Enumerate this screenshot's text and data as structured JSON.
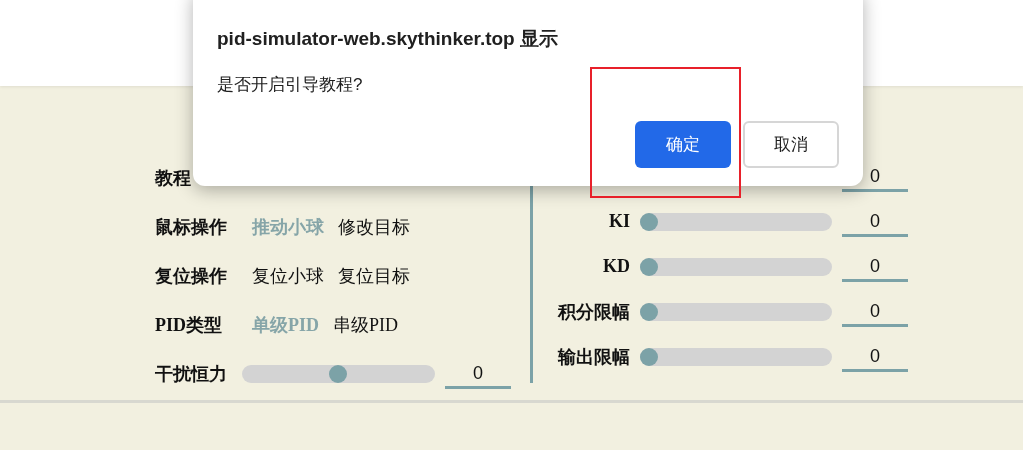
{
  "dialog": {
    "title": "pid-simulator-web.skythinker.top 显示",
    "message": "是否开启引导教程?",
    "buttons": [
      {
        "label": "确定",
        "kind": "primary",
        "highlighted": true
      },
      {
        "label": "取消",
        "kind": "secondary",
        "highlighted": false
      }
    ]
  },
  "controls": [
    {
      "kind": "label_only",
      "label": "教程"
    },
    {
      "kind": "options",
      "label": "鼠标操作",
      "options": [
        {
          "label": "推动小球",
          "selected": true
        },
        {
          "label": "修改目标",
          "selected": false
        }
      ]
    },
    {
      "kind": "options",
      "label": "复位操作",
      "options": [
        {
          "label": "复位小球",
          "selected": false
        },
        {
          "label": "复位目标",
          "selected": false
        }
      ]
    },
    {
      "kind": "options",
      "label": "PID类型",
      "options": [
        {
          "label": "单级PID",
          "selected": true
        },
        {
          "label": "串级PID",
          "selected": false
        }
      ]
    },
    {
      "kind": "slider",
      "label": "干扰恒力",
      "level": 0.5,
      "value": "0"
    }
  ],
  "gains": [
    {
      "kind": "value_only",
      "value": "0"
    },
    {
      "kind": "slider",
      "label": "KI",
      "level": 0,
      "value": "0"
    },
    {
      "kind": "slider",
      "label": "KD",
      "level": 0,
      "value": "0"
    },
    {
      "kind": "slider",
      "label": "积分限幅",
      "level": 0,
      "value": "0"
    },
    {
      "kind": "slider",
      "label": "输出限幅",
      "level": 0,
      "value": "0"
    }
  ]
}
